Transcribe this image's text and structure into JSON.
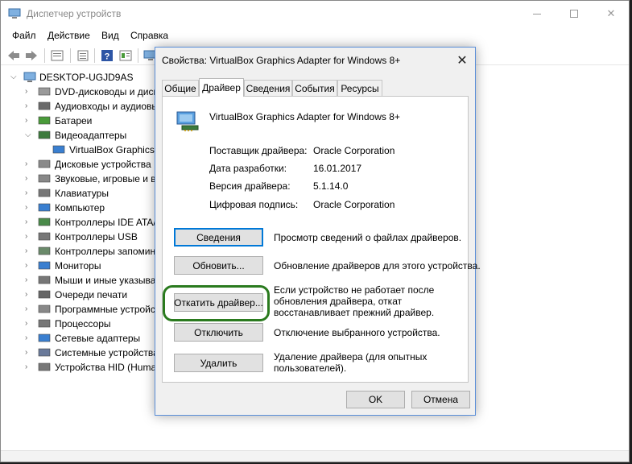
{
  "window": {
    "title": "Диспетчер устройств",
    "minimize": "—",
    "close": "✕"
  },
  "menu": [
    "Файл",
    "Действие",
    "Вид",
    "Справка"
  ],
  "tree": {
    "root": "DESKTOP-UGJD9AS",
    "items": [
      {
        "label": "DVD-дисководы и диск",
        "icon": "dvd-icon"
      },
      {
        "label": "Аудиовходы и аудиовых",
        "icon": "audio-icon"
      },
      {
        "label": "Батареи",
        "icon": "battery-icon"
      },
      {
        "label": "Видеоадаптеры",
        "icon": "display-adapter-icon",
        "expanded": true
      },
      {
        "label": "VirtualBox Graphics",
        "icon": "monitor-icon",
        "child": true
      },
      {
        "label": "Дисковые устройства",
        "icon": "disk-icon"
      },
      {
        "label": "Звуковые, игровые и в",
        "icon": "sound-icon"
      },
      {
        "label": "Клавиатуры",
        "icon": "keyboard-icon"
      },
      {
        "label": "Компьютер",
        "icon": "computer-icon"
      },
      {
        "label": "Контроллеры IDE ATA/",
        "icon": "ide-icon"
      },
      {
        "label": "Контроллеры USB",
        "icon": "usb-icon"
      },
      {
        "label": "Контроллеры запомин",
        "icon": "storage-icon"
      },
      {
        "label": "Мониторы",
        "icon": "monitor-icon"
      },
      {
        "label": "Мыши и иные указыва",
        "icon": "mouse-icon"
      },
      {
        "label": "Очереди печати",
        "icon": "printer-icon"
      },
      {
        "label": "Программные устройс",
        "icon": "software-icon"
      },
      {
        "label": "Процессоры",
        "icon": "cpu-icon"
      },
      {
        "label": "Сетевые адаптеры",
        "icon": "network-icon"
      },
      {
        "label": "Системные устройства",
        "icon": "system-icon"
      },
      {
        "label": "Устройства HID (Huma",
        "icon": "hid-icon"
      }
    ]
  },
  "dialog": {
    "title": "Свойства: VirtualBox Graphics Adapter for Windows 8+",
    "close": "✕",
    "tabs": [
      "Общие",
      "Драйвер",
      "Сведения",
      "События",
      "Ресурсы"
    ],
    "active_tab": "Драйвер",
    "device_name": "VirtualBox Graphics Adapter for Windows 8+",
    "properties": [
      {
        "label": "Поставщик драйвера:",
        "value": "Oracle Corporation"
      },
      {
        "label": "Дата разработки:",
        "value": "16.01.2017"
      },
      {
        "label": "Версия драйвера:",
        "value": "5.1.14.0"
      },
      {
        "label": "Цифровая подпись:",
        "value": "Oracle Corporation"
      }
    ],
    "actions": [
      {
        "button": "Сведения",
        "desc": [
          "Просмотр сведений о файлах драйверов."
        ]
      },
      {
        "button": "Обновить...",
        "desc": [
          "Обновление драйверов для этого устройства."
        ]
      },
      {
        "button": "Откатить драйвер...",
        "desc": [
          "Если устройство не работает после",
          "обновления драйвера, откат",
          "восстанавливает прежний драйвер."
        ]
      },
      {
        "button": "Отключить",
        "desc": [
          "Отключение выбранного устройства."
        ]
      },
      {
        "button": "Удалить",
        "desc": [
          "Удаление драйвера (для опытных",
          "пользователей)."
        ]
      }
    ],
    "ok": "OK",
    "cancel": "Отмена",
    "highlight_color": "#2a7a1e"
  }
}
